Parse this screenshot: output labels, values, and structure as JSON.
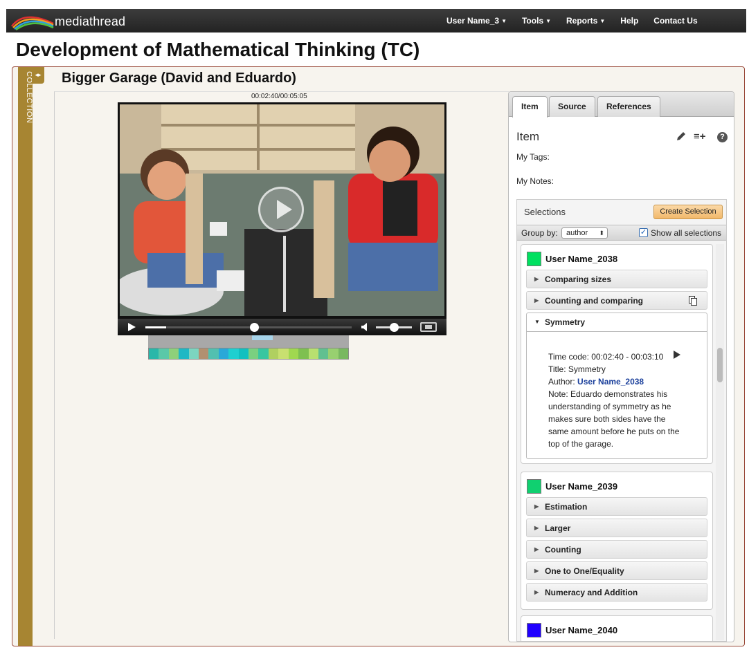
{
  "app": {
    "name": "mediathread"
  },
  "nav": {
    "user": "User Name_3",
    "tools": "Tools",
    "reports": "Reports",
    "help": "Help",
    "contact": "Contact Us"
  },
  "page": {
    "title": "Development of Mathematical Thinking (TC)"
  },
  "collection": {
    "label": "COLLECTION",
    "toggle_icon": "double-arrow-icon"
  },
  "item": {
    "title": "Bigger Garage (David and Eduardo)"
  },
  "video": {
    "timecode": "00:02:40/00:05:05",
    "progress": 0.1,
    "position_fraction": 0.527,
    "volume": 0.5
  },
  "clip_strip_colors": [
    "#2ab7a9",
    "#5ac8a8",
    "#8ed07a",
    "#1fb8c4",
    "#7cd5c0",
    "#b29070",
    "#52c0b0",
    "#2aa8d8",
    "#1fcfd0",
    "#10c0c0",
    "#7ad080",
    "#39c6a0",
    "#b0d060",
    "#c8e070",
    "#a0d850",
    "#7ec050",
    "#b8e070",
    "#60c090",
    "#98d070",
    "#78b860"
  ],
  "tabs": {
    "item": "Item",
    "source": "Source",
    "references": "References"
  },
  "panel": {
    "heading": "Item",
    "my_tags": "My Tags:",
    "my_notes": "My Notes:",
    "icons": [
      "pencil-icon",
      "add-to-list-icon",
      "help-icon"
    ]
  },
  "selections": {
    "title": "Selections",
    "create_label": "Create Selection",
    "group_by_label": "Group by:",
    "group_by_value": "author",
    "show_all_label": "Show all selections",
    "show_all_checked": true
  },
  "authors": [
    {
      "name": "User Name_2038",
      "color": "#00e060",
      "annotations": [
        "Comparing sizes",
        "Counting and comparing"
      ],
      "open": {
        "title": "Symmetry",
        "timecode": "Time code: 00:02:40 - 00:03:10",
        "title_line": "Title: Symmetry",
        "author_prefix": "Author: ",
        "author": "User Name_2038",
        "note": [
          "Note: Eduardo demonstrates his",
          "understanding of symmetry as he",
          "makes sure both sides have the",
          "same amount before he puts on the",
          "top of the garage."
        ]
      }
    },
    {
      "name": "User Name_2039",
      "color": "#10d070",
      "annotations": [
        "Estimation",
        "Larger",
        "Counting",
        "One to One/Equality",
        "Numeracy and Addition"
      ]
    },
    {
      "name": "User Name_2040",
      "color": "#2000ff",
      "annotations": []
    }
  ]
}
